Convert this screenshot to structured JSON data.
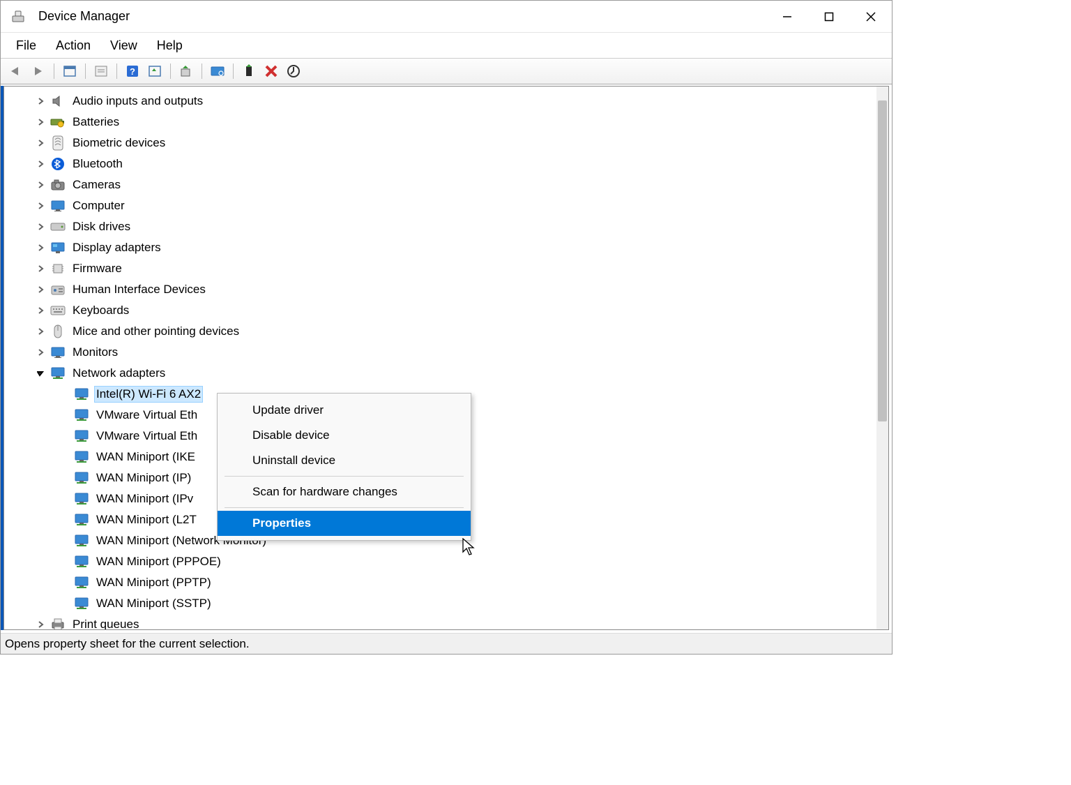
{
  "titlebar": {
    "title": "Device Manager"
  },
  "menubar": {
    "items": [
      "File",
      "Action",
      "View",
      "Help"
    ]
  },
  "toolbar": {
    "buttons": [
      "back",
      "forward",
      "show-hidden",
      "properties-sheet",
      "help",
      "properties",
      "update-driver",
      "scan",
      "uninstall",
      "disable",
      "enable"
    ]
  },
  "tree": {
    "categories": [
      {
        "label": "Audio inputs and outputs",
        "icon": "speaker",
        "expanded": false
      },
      {
        "label": "Batteries",
        "icon": "battery",
        "expanded": false
      },
      {
        "label": "Biometric devices",
        "icon": "fingerprint",
        "expanded": false
      },
      {
        "label": "Bluetooth",
        "icon": "bluetooth",
        "expanded": false
      },
      {
        "label": "Cameras",
        "icon": "camera",
        "expanded": false
      },
      {
        "label": "Computer",
        "icon": "monitor",
        "expanded": false
      },
      {
        "label": "Disk drives",
        "icon": "disk",
        "expanded": false
      },
      {
        "label": "Display adapters",
        "icon": "display",
        "expanded": false
      },
      {
        "label": "Firmware",
        "icon": "chip",
        "expanded": false
      },
      {
        "label": "Human Interface Devices",
        "icon": "hid",
        "expanded": false
      },
      {
        "label": "Keyboards",
        "icon": "keyboard",
        "expanded": false
      },
      {
        "label": "Mice and other pointing devices",
        "icon": "mouse",
        "expanded": false
      },
      {
        "label": "Monitors",
        "icon": "monitor",
        "expanded": false
      },
      {
        "label": "Network adapters",
        "icon": "network",
        "expanded": true,
        "children": [
          {
            "label": "Intel(R) Wi-Fi 6 AX2",
            "selected": true
          },
          {
            "label": "VMware Virtual Eth"
          },
          {
            "label": "VMware Virtual Eth"
          },
          {
            "label": "WAN Miniport (IKE"
          },
          {
            "label": "WAN Miniport (IP)"
          },
          {
            "label": "WAN Miniport (IPv"
          },
          {
            "label": "WAN Miniport (L2T"
          },
          {
            "label": "WAN Miniport (Network Monitor)"
          },
          {
            "label": "WAN Miniport (PPPOE)"
          },
          {
            "label": "WAN Miniport (PPTP)"
          },
          {
            "label": "WAN Miniport (SSTP)"
          }
        ]
      },
      {
        "label": "Print queues",
        "icon": "printer",
        "expanded": false
      }
    ]
  },
  "context_menu": {
    "items": [
      {
        "label": "Update driver",
        "type": "item"
      },
      {
        "label": "Disable device",
        "type": "item"
      },
      {
        "label": "Uninstall device",
        "type": "item"
      },
      {
        "type": "sep"
      },
      {
        "label": "Scan for hardware changes",
        "type": "item"
      },
      {
        "type": "sep"
      },
      {
        "label": "Properties",
        "type": "item",
        "highlighted": true
      }
    ]
  },
  "statusbar": {
    "text": "Opens property sheet for the current selection."
  }
}
